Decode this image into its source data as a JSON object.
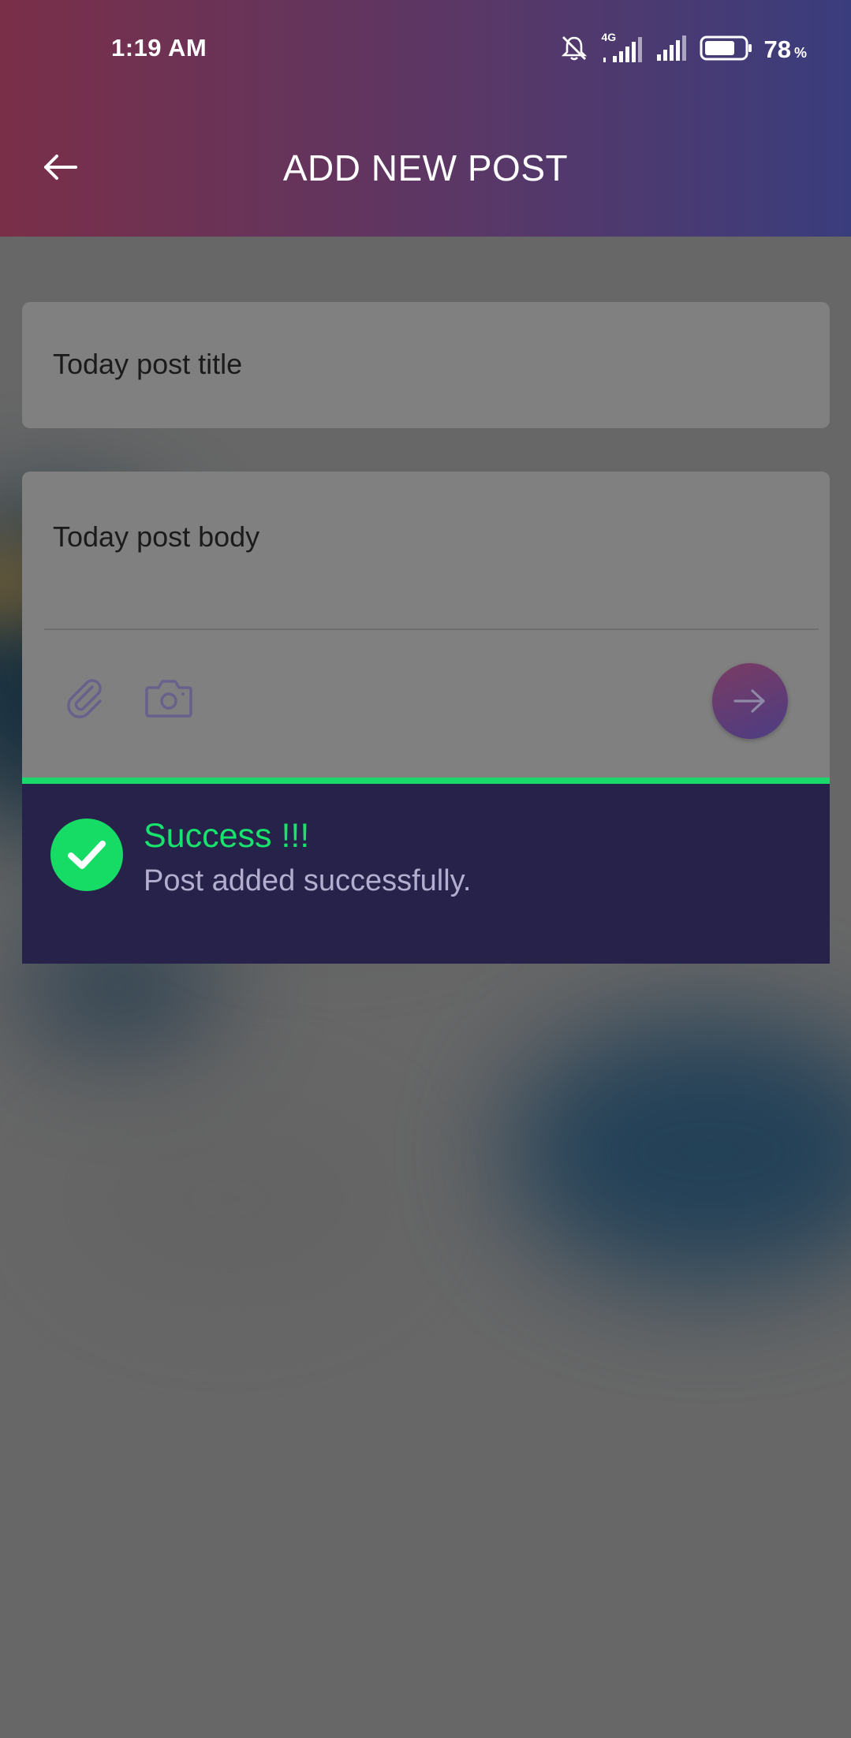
{
  "status_bar": {
    "time": "1:19 AM",
    "network_label": "4G",
    "battery_percent": "78",
    "battery_unit": "%",
    "battery_level": 0.78,
    "icons": [
      "muted-bell-icon",
      "signal-4g-icon",
      "signal-icon",
      "battery-icon"
    ]
  },
  "header": {
    "title": "ADD NEW POST",
    "back_icon": "arrow-left-icon"
  },
  "form": {
    "title_value": "Today post title",
    "body_value": "Today post body",
    "attach_icon": "paperclip-icon",
    "camera_icon": "camera-icon",
    "send_icon": "arrow-right-icon"
  },
  "toast": {
    "title": "Success !!!",
    "message": "Post added successfully.",
    "icon": "check-circle-icon",
    "accent_color": "#19d86c",
    "background_color": "#272249"
  },
  "colors": {
    "header_gradient_start": "#7a2f48",
    "header_gradient_end": "#3a3d7d",
    "overlay": "#666666"
  }
}
